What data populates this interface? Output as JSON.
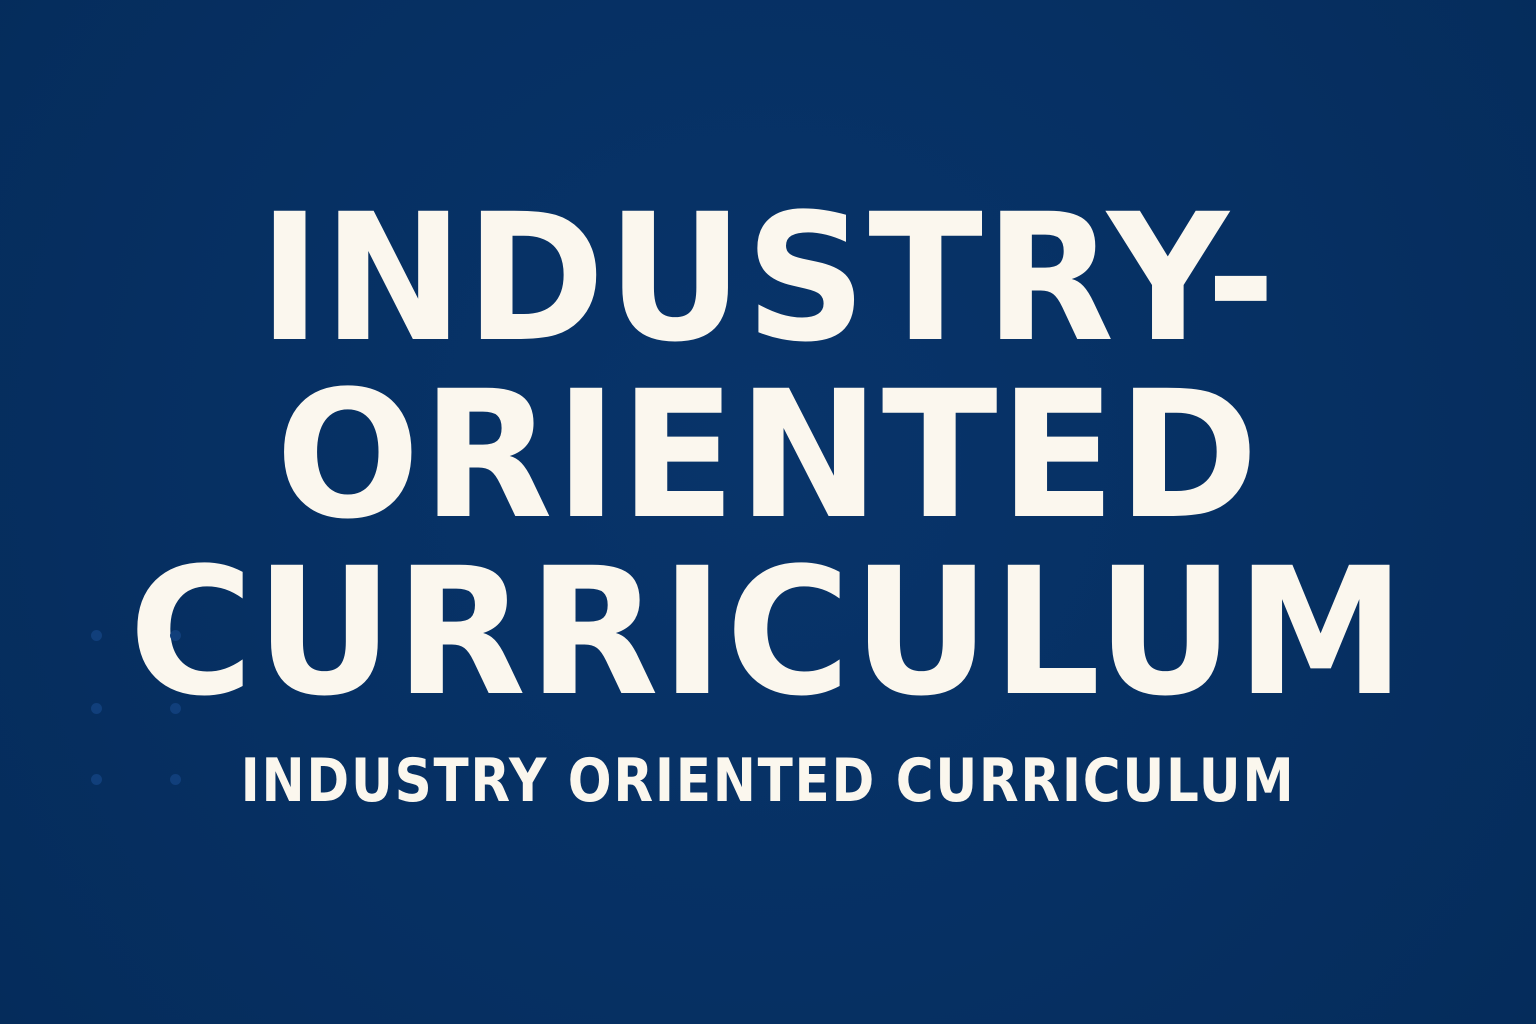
{
  "title": {
    "lines": [
      "INDUSTRY-",
      "ORIENTED",
      "CURRICULUM"
    ]
  },
  "subtitle": "INDUSTRY ORIENTED CURRICULUM",
  "colors": {
    "background": "#063063",
    "text": "#fbf7ee",
    "dots": "#113f7b"
  }
}
